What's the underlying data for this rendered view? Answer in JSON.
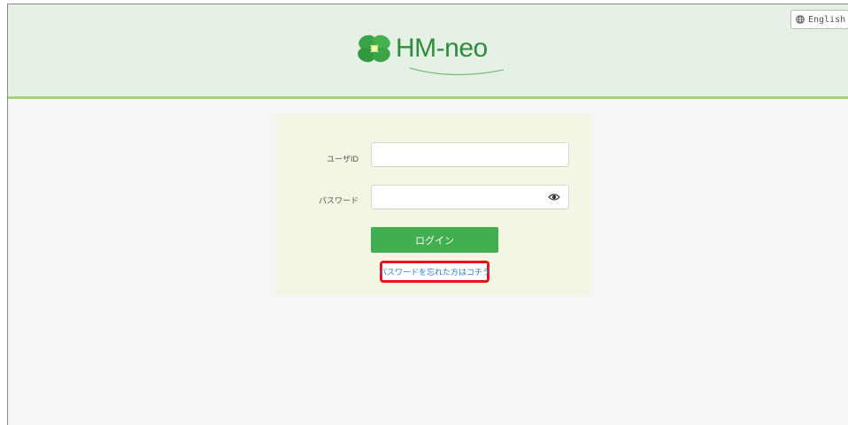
{
  "header": {
    "language_button": "English",
    "logo_text": "HM-neo"
  },
  "login_form": {
    "user_id_label": "ユーザID",
    "password_label": "パスワード",
    "user_id_value": "",
    "password_value": "",
    "login_button": "ログイン",
    "forgot_password_link": "パスワードを忘れた方はコチラ"
  },
  "colors": {
    "header_bg": "#e6f1e5",
    "header_border": "#a9d07f",
    "panel_bg": "#f4f6e4",
    "login_button": "#41af50",
    "link": "#2a7fd4",
    "highlight": "#e8141b",
    "logo_text": "#2e8d3c"
  },
  "icons": {
    "language": "globe-icon",
    "password_toggle": "eye-icon",
    "logo": "four-leaf-clover"
  }
}
